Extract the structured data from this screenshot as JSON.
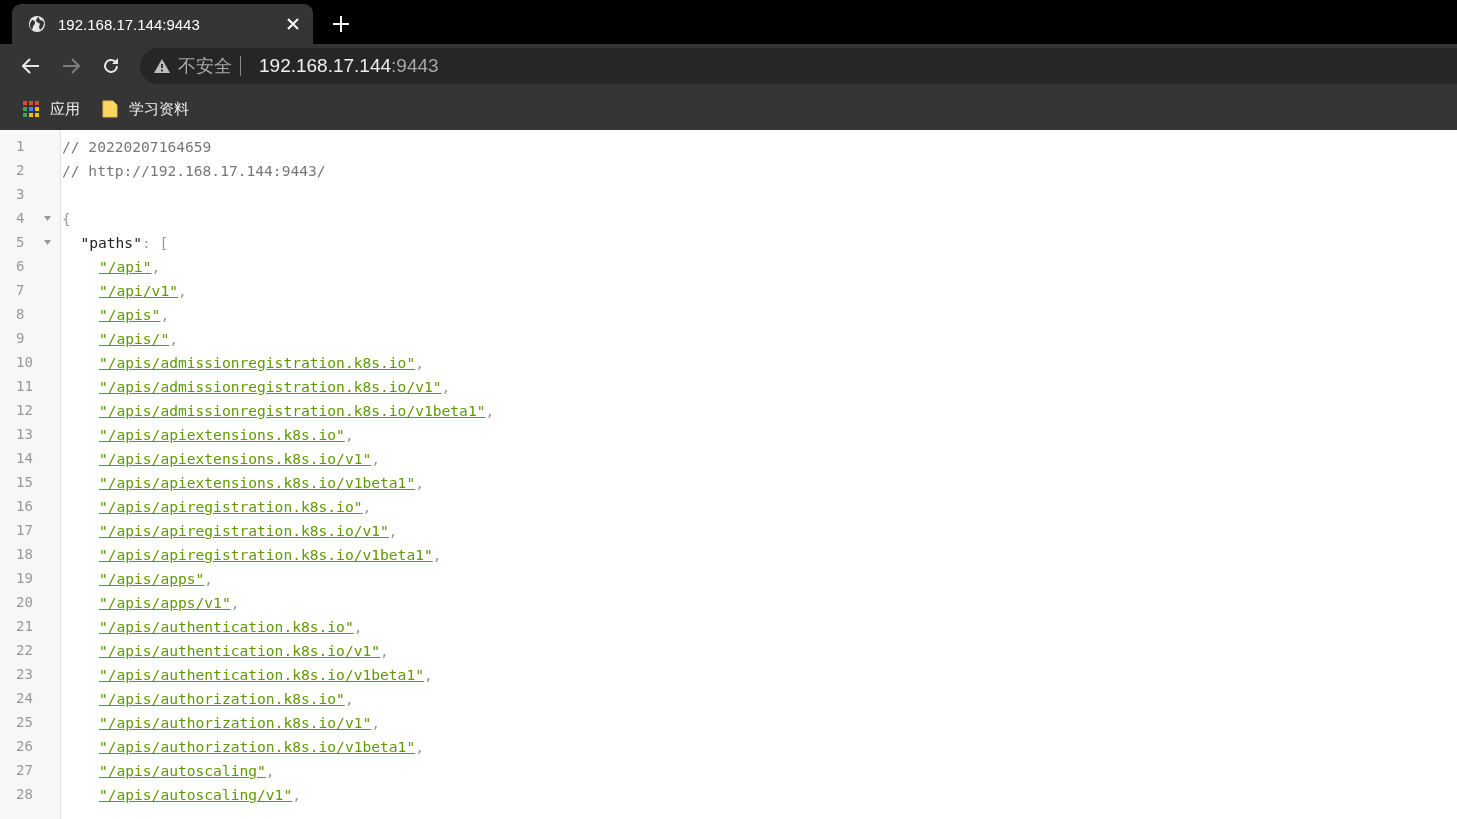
{
  "tab": {
    "title": "192.168.17.144:9443",
    "selected": true
  },
  "address_bar": {
    "security": "不安全",
    "host": "192.168.17.144",
    "port": ":9443"
  },
  "toolbar": {
    "back_disabled": false,
    "forward_disabled": true
  },
  "bookmarks": [
    {
      "kind": "apps",
      "label": "应用"
    },
    {
      "kind": "folder",
      "label": "学习资料"
    }
  ],
  "lines": [
    {
      "number": "1",
      "kind": "comment",
      "text": "// 20220207164659"
    },
    {
      "number": "2",
      "kind": "comment",
      "text": "// http://192.168.17.144:9443/"
    },
    {
      "number": "3",
      "kind": "blank"
    },
    {
      "number": "4",
      "kind": "punct",
      "text": "{",
      "foldable": true,
      "children": [
        {
          "number": "5",
          "kind": "key",
          "key": "\"paths\"",
          "text": ": [",
          "foldable": true,
          "children": [
            {
              "number": "6",
              "kind": "link",
              "text": "\"/api\"",
              "suffix": ","
            },
            {
              "number": "7",
              "kind": "link",
              "text": "\"/api/v1\"",
              "suffix": ","
            },
            {
              "number": "8",
              "kind": "link",
              "text": "\"/apis\"",
              "suffix": ","
            },
            {
              "number": "9",
              "kind": "link",
              "text": "\"/apis/\"",
              "suffix": ","
            },
            {
              "number": "10",
              "kind": "link",
              "text": "\"/apis/admissionregistration.k8s.io\"",
              "suffix": ","
            },
            {
              "number": "11",
              "kind": "link",
              "text": "\"/apis/admissionregistration.k8s.io/v1\"",
              "suffix": ","
            },
            {
              "number": "12",
              "kind": "link",
              "text": "\"/apis/admissionregistration.k8s.io/v1beta1\"",
              "suffix": ","
            },
            {
              "number": "13",
              "kind": "link",
              "text": "\"/apis/apiextensions.k8s.io\"",
              "suffix": ","
            },
            {
              "number": "14",
              "kind": "link",
              "text": "\"/apis/apiextensions.k8s.io/v1\"",
              "suffix": ","
            },
            {
              "number": "15",
              "kind": "link",
              "text": "\"/apis/apiextensions.k8s.io/v1beta1\"",
              "suffix": ","
            },
            {
              "number": "16",
              "kind": "link",
              "text": "\"/apis/apiregistration.k8s.io\"",
              "suffix": ","
            },
            {
              "number": "17",
              "kind": "link",
              "text": "\"/apis/apiregistration.k8s.io/v1\"",
              "suffix": ","
            },
            {
              "number": "18",
              "kind": "link",
              "text": "\"/apis/apiregistration.k8s.io/v1beta1\"",
              "suffix": ","
            },
            {
              "number": "19",
              "kind": "link",
              "text": "\"/apis/apps\"",
              "suffix": ","
            },
            {
              "number": "20",
              "kind": "link",
              "text": "\"/apis/apps/v1\"",
              "suffix": ","
            },
            {
              "number": "21",
              "kind": "link",
              "text": "\"/apis/authentication.k8s.io\"",
              "suffix": ","
            },
            {
              "number": "22",
              "kind": "link",
              "text": "\"/apis/authentication.k8s.io/v1\"",
              "suffix": ","
            },
            {
              "number": "23",
              "kind": "link",
              "text": "\"/apis/authentication.k8s.io/v1beta1\"",
              "suffix": ","
            },
            {
              "number": "24",
              "kind": "link",
              "text": "\"/apis/authorization.k8s.io\"",
              "suffix": ","
            },
            {
              "number": "25",
              "kind": "link",
              "text": "\"/apis/authorization.k8s.io/v1\"",
              "suffix": ","
            },
            {
              "number": "26",
              "kind": "link",
              "text": "\"/apis/authorization.k8s.io/v1beta1\"",
              "suffix": ","
            },
            {
              "number": "27",
              "kind": "link",
              "text": "\"/apis/autoscaling\"",
              "suffix": ","
            },
            {
              "number": "28",
              "kind": "link",
              "text": "\"/apis/autoscaling/v1\"",
              "suffix": ","
            }
          ]
        }
      ]
    }
  ]
}
